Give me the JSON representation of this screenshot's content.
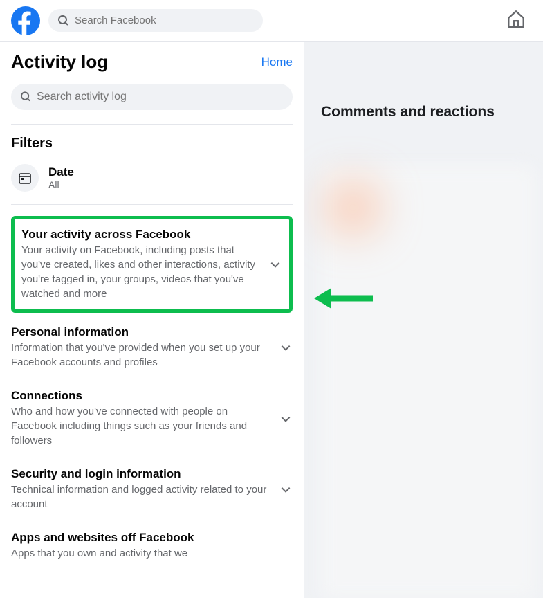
{
  "topbar": {
    "search_placeholder": "Search Facebook"
  },
  "sidebar": {
    "title": "Activity log",
    "home_link": "Home",
    "search_placeholder": "Search activity log",
    "filters_title": "Filters",
    "date_filter": {
      "label": "Date",
      "value": "All"
    }
  },
  "sections": [
    {
      "title": "Your activity across Facebook",
      "desc": "Your activity on Facebook, including posts that you've created, likes and other interactions, activity you're tagged in, your groups, videos that you've watched and more"
    },
    {
      "title": "Personal information",
      "desc": "Information that you've provided when you set up your Facebook accounts and profiles"
    },
    {
      "title": "Connections",
      "desc": "Who and how you've connected with people on Facebook including things such as your friends and followers"
    },
    {
      "title": "Security and login information",
      "desc": "Technical information and logged activity related to your account"
    },
    {
      "title": "Apps and websites off Facebook",
      "desc": "Apps that you own and activity that we"
    }
  ],
  "main": {
    "heading": "Comments and reactions"
  },
  "colors": {
    "brand": "#1877f2",
    "highlight": "#0dbd4e",
    "text_primary": "#050505",
    "text_secondary": "#65676b"
  }
}
